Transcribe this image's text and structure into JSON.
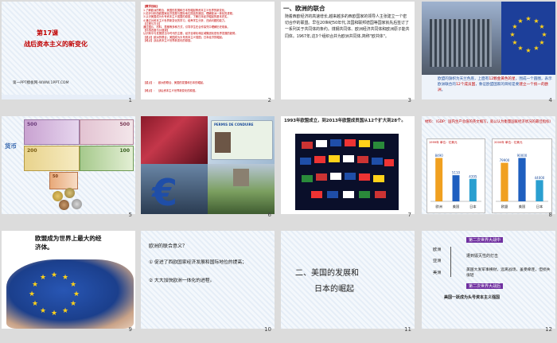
{
  "slides": [
    {
      "num": "1",
      "lesson": "第17课",
      "title": "战后资本主义的新变化",
      "footer": "第一PPT模板网-WWW.1PPT.COM"
    },
    {
      "num": "2",
      "notes_title": "【教学目标】",
      "notes": "1.了解欧洲的联合、美国的发展和日本的崛起等资本主义世界的新变化。\n2.初步分析西欧国家经济发展与国际地位提高的原因，理解欧洲一体化的进程。\n3.认识美国成为头号资本主义强国的原因，了解日本经济崛起的基本史实。\n4.通过对资本主义世界新变化的学习，培养学生分析、归纳问题的能力。\n【过程与方法】\n通过图片、材料、表格等多种方式，引导学生在合作探究中理解历史现象。\n【情感态度与价值观】\n认识和平与发展是当今时代的主题，经济全球化和区域集团化是世界发展的趋势。\n【重点】欧洲的联合；美国成为头号资本主义强国；日本经济的崛起。\n【难点】战后资本主义世界新变化的原因。",
      "key": "【重点】：",
      "key_text": "欧洲的联合、美国的发展和日本的崛起。",
      "diff": "【难点】：",
      "diff_text": "战后资本主义世界新变化的原因。"
    },
    {
      "num": "3",
      "heading": "一、欧洲的联合",
      "body": "随着西欧经济的高速增长,越来越多的西欧国家的领导人主张建立一个密切合作的联盟。早在20世纪50年代,法国和联邦德国等国家就先后签订了一系列关于共同体的条约。煤钢共同体、欧洲经济共同体和欧洲原子能共同体。1967年,这3个组织合并为欧洲共同体,简称\"欧共体\"。"
    },
    {
      "num": "4",
      "caption_a": "欧盟的旗帜为天兰色底，上面有",
      "caption_b": "12颗金黄色的星",
      "caption_c": "，围成一个圆圈，表示欧洲联合的",
      "caption_d": "12个成员国",
      "caption_e": "，象征",
      "caption_f": "欧盟国家的目标是要",
      "caption_g": "建立一个统一的欧洲",
      "caption_h": "。"
    },
    {
      "num": "5",
      "label": "货币",
      "notes": [
        "500",
        "200",
        "100",
        "50"
      ]
    },
    {
      "num": "6",
      "card": "PERMIS DE CONDUIRE"
    },
    {
      "num": "7",
      "text": "1993年欧盟成立，到2013年欧盟成员国从12个扩大到28个。"
    },
    {
      "num": "8",
      "material": "材料：（GDP：国内生产总值的英文缩写，就公认为衡量国家经济状况的最佳指标）",
      "chart1": {
        "unit": "1999年 单位：亿美元",
        "categories": [
          "欧洲",
          "美国",
          "日本"
        ],
        "values": [
          8490,
          5110,
          4395
        ]
      },
      "chart2": {
        "unit": "2000年 单位：亿美元",
        "categories": [
          "欧盟",
          "美国",
          "日本"
        ],
        "values": [
          79900,
          90000,
          44000
        ]
      }
    },
    {
      "num": "9",
      "title": "欧盟成为世界上最大的经济体。"
    },
    {
      "num": "10",
      "q": "欧洲的联合意义？",
      "items": [
        "① 促进了西欧国家经济发展和国际地位的提高；",
        "② 大大加快欧洲一体化的进程。"
      ]
    },
    {
      "num": "11",
      "title_a": "二、美国的发展和",
      "title_b": "日本的崛起"
    },
    {
      "num": "12",
      "h1": "第二次世界大战中",
      "regions": [
        "欧洲",
        "亚洲",
        "美洲"
      ],
      "r1": "遭到毁灭性的打击",
      "r2": "美国大发军事横财，远离战场，虽受牵连，但损失很轻",
      "h2": "第二次世界大战后",
      "r3": "美国一跃成为头号资本主义强国"
    }
  ],
  "colors": {
    "red": "#c00000",
    "blue": "#1f4e9c",
    "gray_bg": "#dcdcdc"
  }
}
